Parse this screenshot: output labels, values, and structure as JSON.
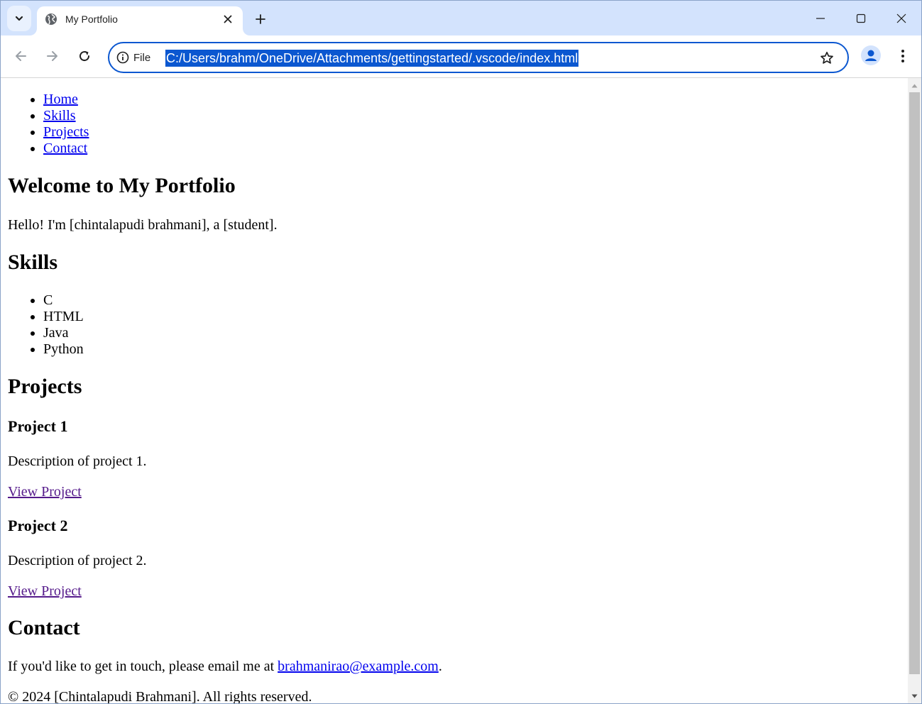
{
  "browser": {
    "tab": {
      "title": "My Portfolio"
    },
    "address_bar": {
      "site_label": "File",
      "url": "C:/Users/brahm/OneDrive/Attachments/gettingstarted/.vscode/index.html"
    }
  },
  "page": {
    "nav": [
      "Home",
      "Skills",
      "Projects",
      "Contact"
    ],
    "welcome_heading": "Welcome to My Portfolio",
    "intro": "Hello! I'm [chintalapudi brahmani], a [student].",
    "skills_heading": "Skills",
    "skills": [
      "C",
      "HTML",
      "Java",
      "Python"
    ],
    "projects_heading": "Projects",
    "projects": [
      {
        "title": "Project 1",
        "description": "Description of project 1.",
        "link": "View Project"
      },
      {
        "title": "Project 2",
        "description": "Description of project 2.",
        "link": "View Project"
      }
    ],
    "contact_heading": "Contact",
    "contact_text": "If you'd like to get in touch, please email me at ",
    "contact_email": "brahmanirao@example.com",
    "contact_period": ".",
    "footer": "© 2024 [Chintalapudi Brahmani]. All rights reserved."
  },
  "colors": {
    "tabstrip_bg": "#d3e3fd",
    "accent": "#0b57d0",
    "link": "#0000ee",
    "visited_link": "#551a8b"
  },
  "icons": [
    "tab-search-icon",
    "globe-icon",
    "close-icon",
    "plus-icon",
    "minimize-icon",
    "maximize-icon",
    "window-close-icon",
    "back-arrow-icon",
    "forward-arrow-icon",
    "reload-icon",
    "info-icon",
    "star-icon",
    "profile-icon",
    "more-vert-icon"
  ]
}
